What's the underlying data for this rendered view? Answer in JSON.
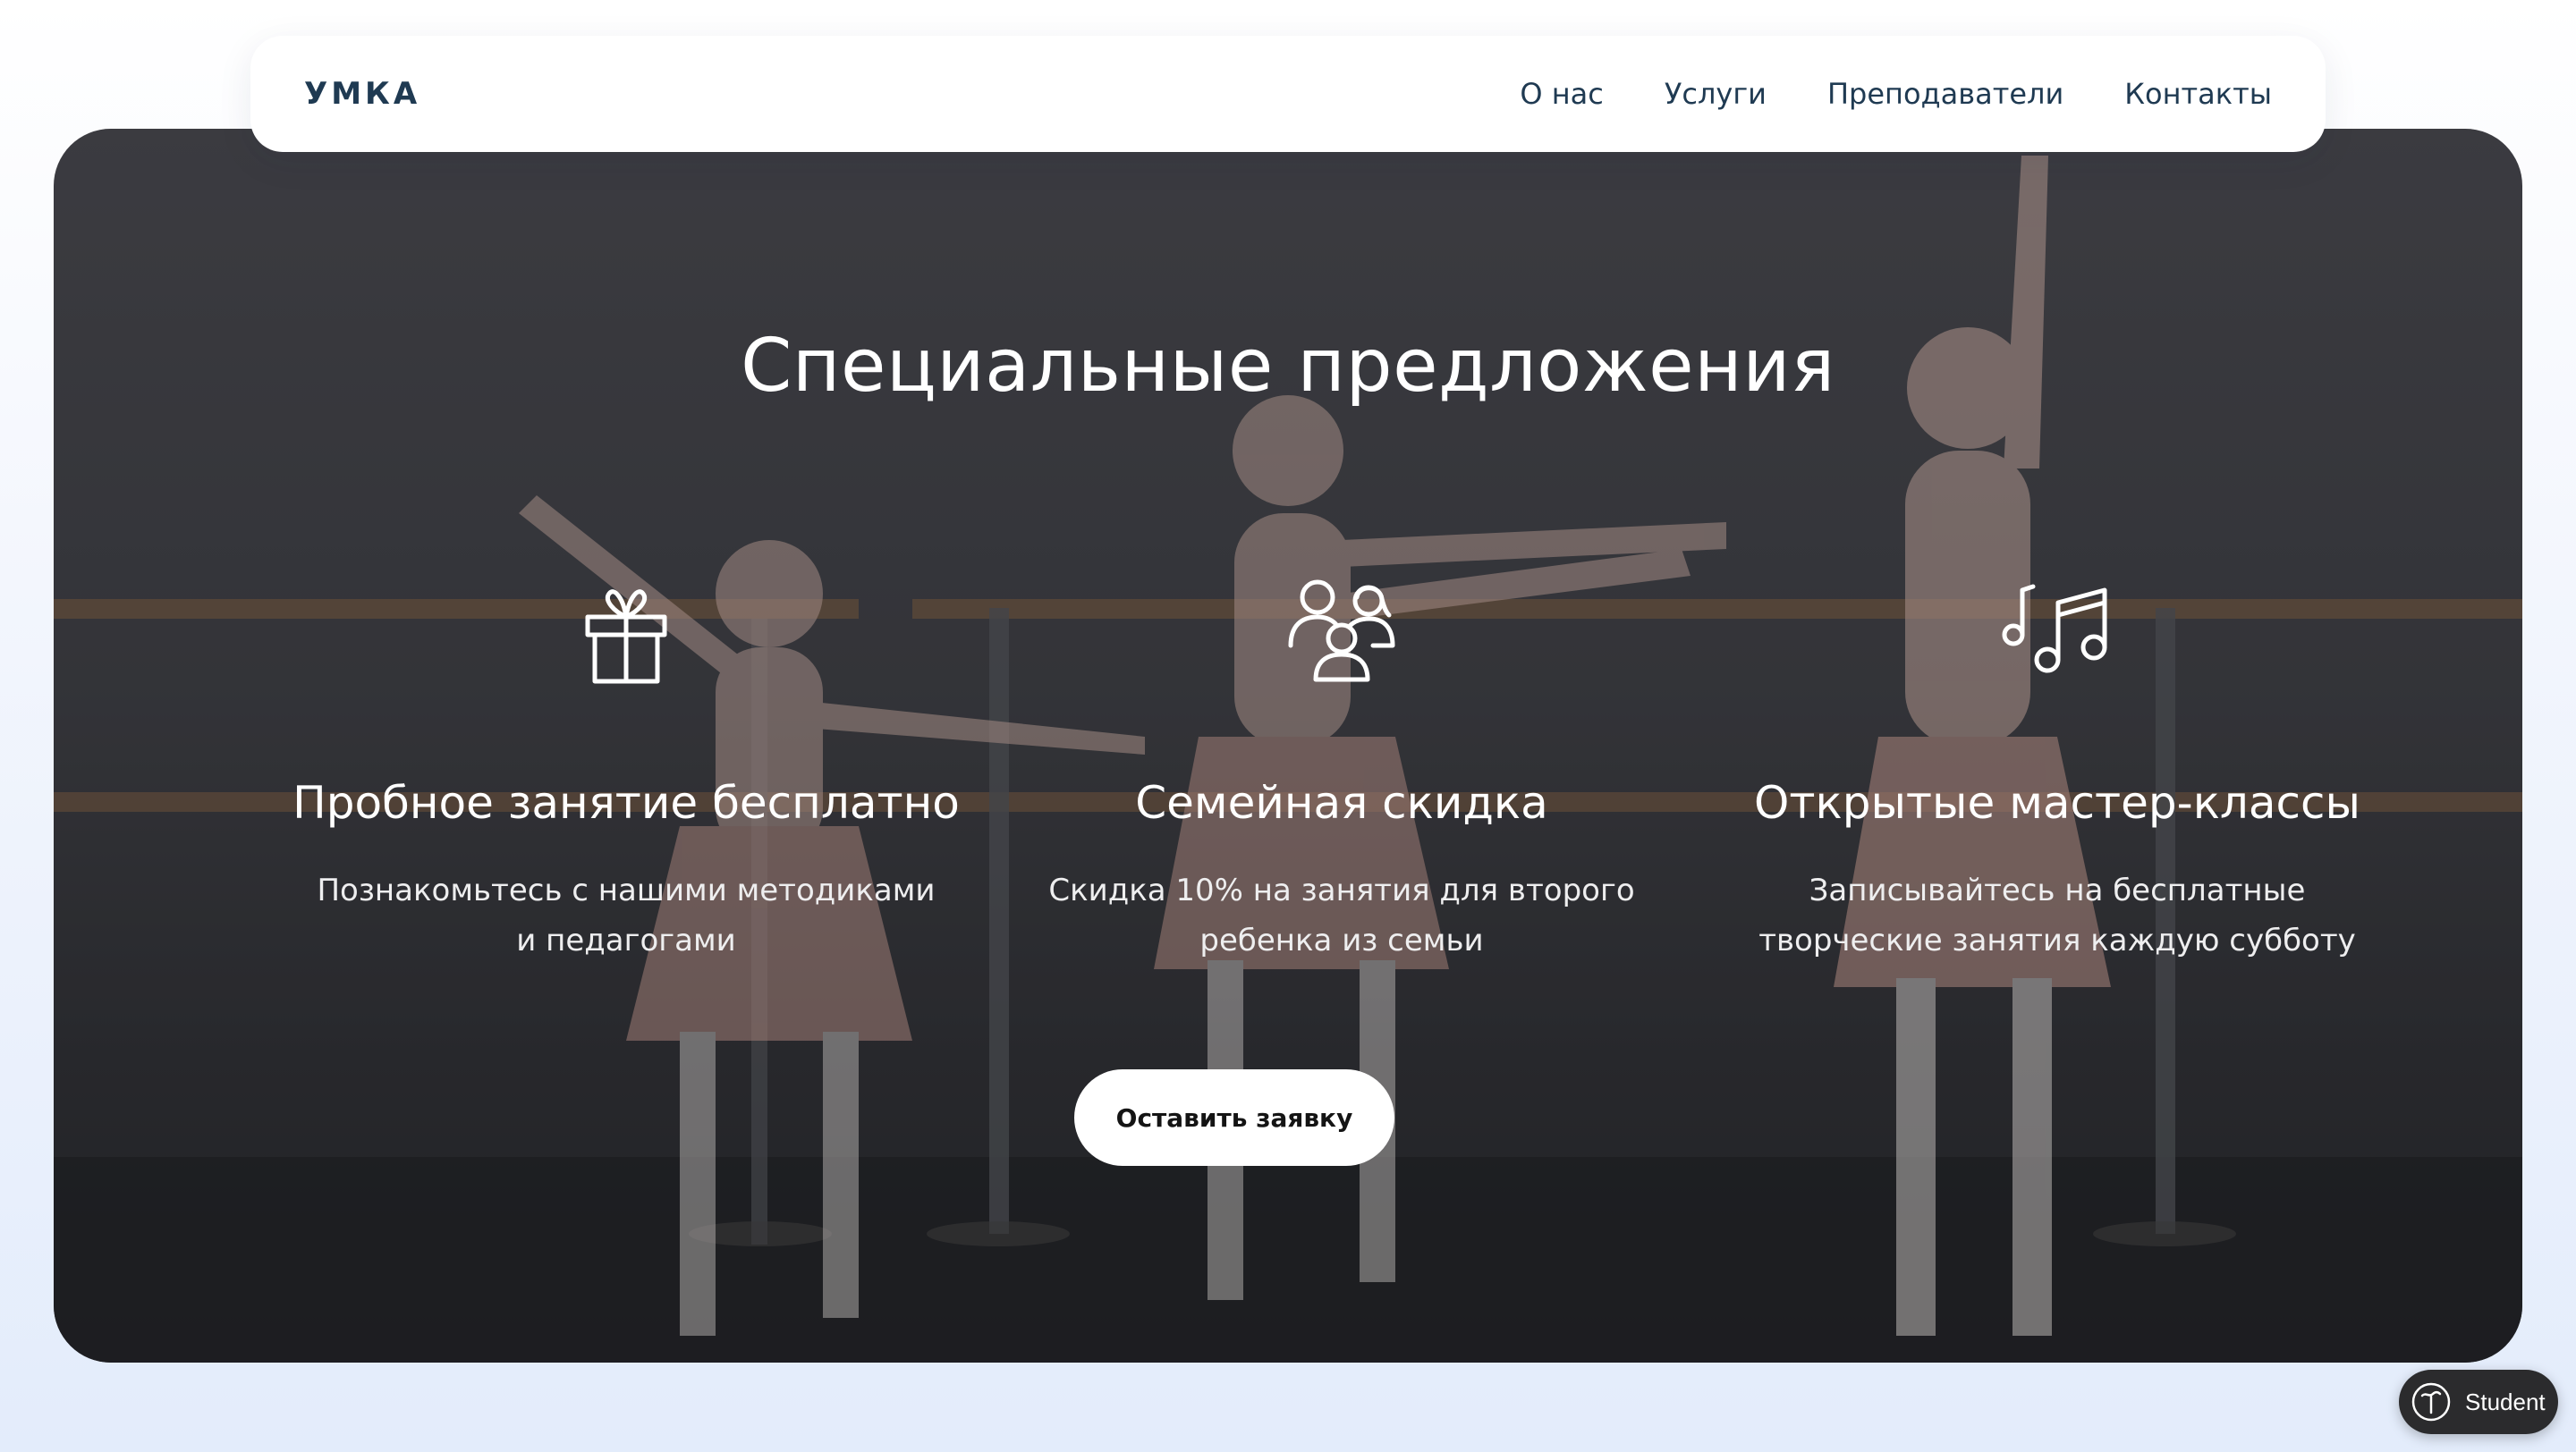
{
  "brand": {
    "logo_text": "УМКА"
  },
  "nav": {
    "items": [
      {
        "label": "О нас"
      },
      {
        "label": "Услуги"
      },
      {
        "label": "Преподаватели"
      },
      {
        "label": "Контакты"
      }
    ]
  },
  "hero": {
    "image_description_icon": "ballet-dancers-photo",
    "title": "Специальные предложения",
    "offers": [
      {
        "icon": "gift-icon",
        "title": "Пробное занятие бесплатно",
        "text": "Познакомьтесь с нашими методиками и педагогами"
      },
      {
        "icon": "family-icon",
        "title": "Семейная скидка",
        "text": "Скидка 10% на занятия для второго ребенка из семьи"
      },
      {
        "icon": "music-notes-icon",
        "title": "Открытые мастер-классы",
        "text": "Записывайтесь на бесплатные творческие занятия каждую субботу"
      }
    ],
    "cta_label": "Оставить заявку"
  },
  "badge": {
    "icon": "tilda-logo-icon",
    "label": "Student"
  },
  "colors": {
    "nav_text": "#1f3a52",
    "hero_overlay": "#3f4045",
    "button_bg": "#ffffff",
    "badge_bg": "#2b2b2d"
  }
}
